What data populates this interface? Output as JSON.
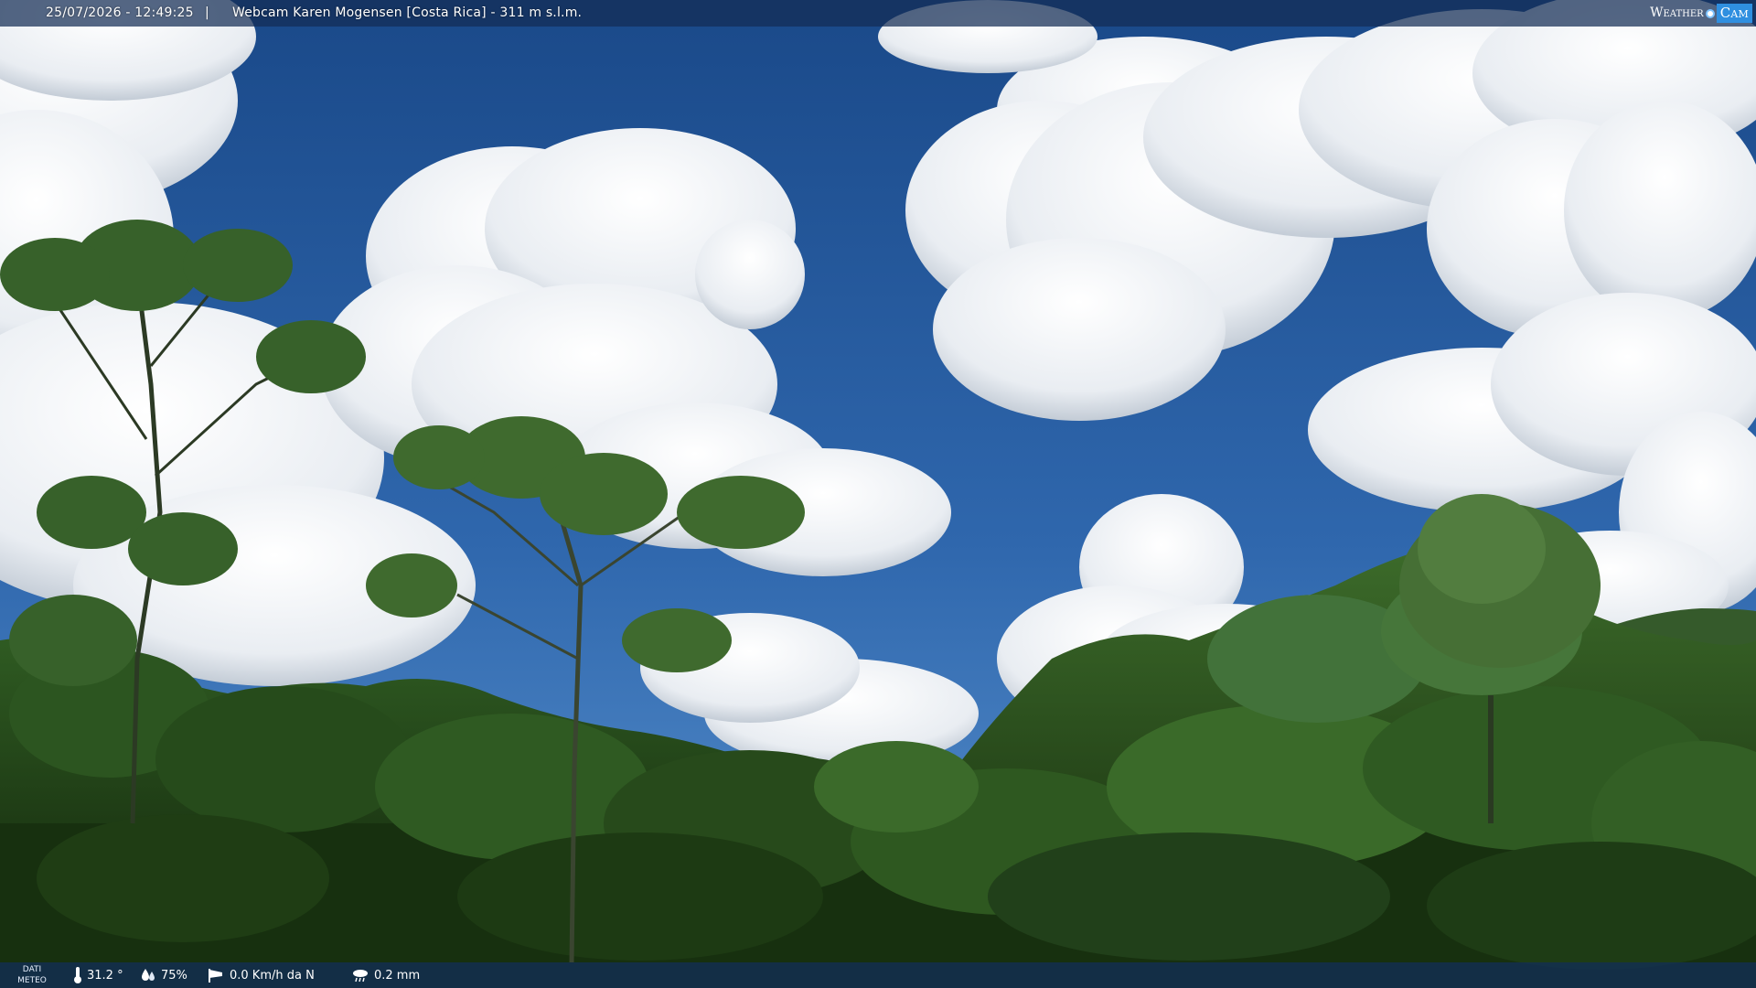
{
  "header": {
    "timestamp": "25/07/2026 - 12:49:25",
    "separator": "|",
    "title": "Webcam Karen Mogensen [Costa Rica]  - 311 m s.l.m.",
    "brand": {
      "weather": "Weather",
      "cam": "Cam",
      "accent_color": "#2f8fe0"
    }
  },
  "weather_bar": {
    "label_line1": "DATI",
    "label_line2": "METEO",
    "temperature": "31.2 °",
    "humidity": "75%",
    "wind": "0.0 Km/h da N",
    "rain": "0.2 mm",
    "icons": [
      "thermometer-icon",
      "humidity-drop-icon",
      "wind-sock-icon",
      "rain-cloud-icon"
    ]
  },
  "scene_colors": {
    "sky_top": "#1d4f93",
    "sky_bottom": "#4a86c6",
    "cloud": "#f1f4f8",
    "cloud_shadow": "#b9c3cf",
    "foliage_dark": "#18300f",
    "foliage_mid": "#2f5a1f",
    "foliage_light": "#5e8f3a"
  }
}
